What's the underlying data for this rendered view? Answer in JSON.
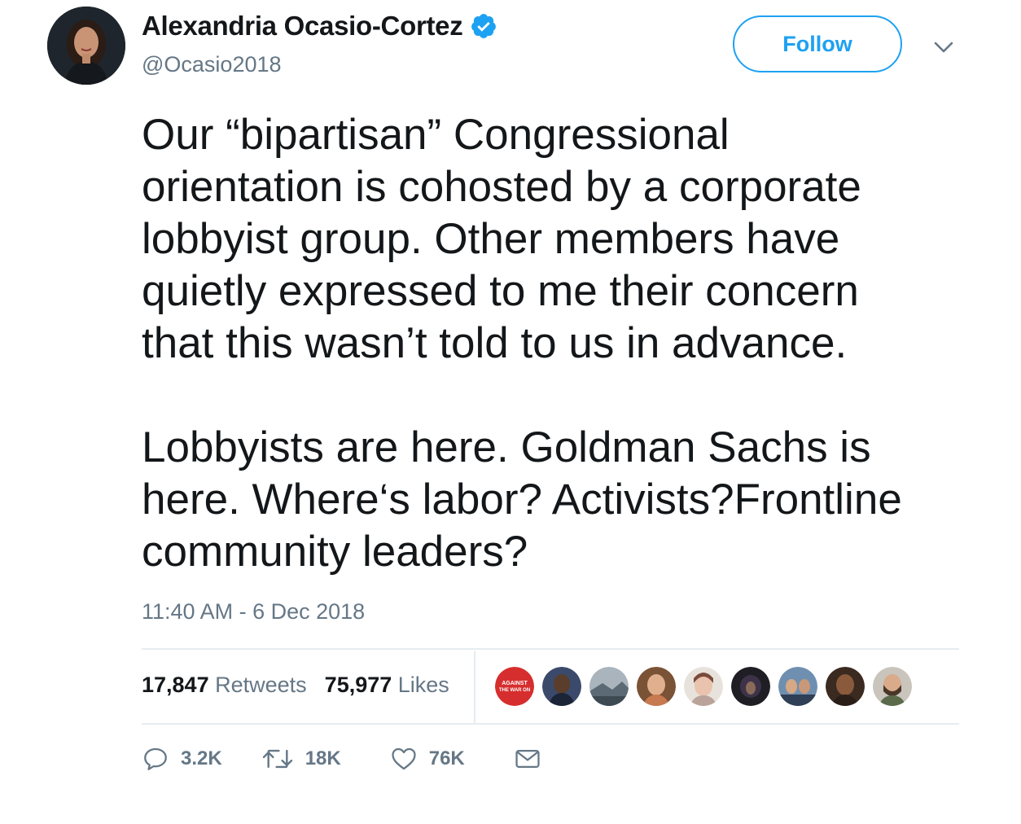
{
  "author": {
    "display_name": "Alexandria Ocasio-Cortez",
    "handle": "@Ocasio2018",
    "verified_icon": "verified-badge-icon"
  },
  "follow_button_label": "Follow",
  "tweet": {
    "paragraphs": [
      "Our “bipartisan” Congressional\norientation is cohosted by a corporate\nlobbyist group. Other members have\nquietly expressed to me their concern\nthat this wasn’t told to us in advance.",
      "Lobbyists are here. Goldman Sachs is\nhere. Where‘s labor? Activists?Frontline\ncommunity leaders?"
    ],
    "timestamp": "11:40 AM - 6 Dec 2018"
  },
  "stats": {
    "retweets_count": "17,847",
    "retweets_label": "Retweets",
    "likes_count": "75,977",
    "likes_label": "Likes"
  },
  "liker_avatars": [
    {
      "name": "liker-avatar-1",
      "color": "#d62e2e",
      "text_lines": [
        "AGAINST",
        "THE WAR ON"
      ]
    },
    {
      "name": "liker-avatar-2",
      "color": "#5a3d2a"
    },
    {
      "name": "liker-avatar-3",
      "color": "#7d8a94"
    },
    {
      "name": "liker-avatar-4",
      "color": "#8b5a3c"
    },
    {
      "name": "liker-avatar-5",
      "color": "#d9b7a4"
    },
    {
      "name": "liker-avatar-6",
      "color": "#2a2a2e"
    },
    {
      "name": "liker-avatar-7",
      "color": "#4a6a8a"
    },
    {
      "name": "liker-avatar-8",
      "color": "#6b4a34"
    },
    {
      "name": "liker-avatar-9",
      "color": "#b08a6a"
    }
  ],
  "actions": {
    "reply_count": "3.2K",
    "retweet_count": "18K",
    "like_count": "76K"
  },
  "colors": {
    "accent": "#1da1f2",
    "secondary_text": "#657786",
    "primary_text": "#14171a",
    "divider": "#e6ecf0"
  }
}
